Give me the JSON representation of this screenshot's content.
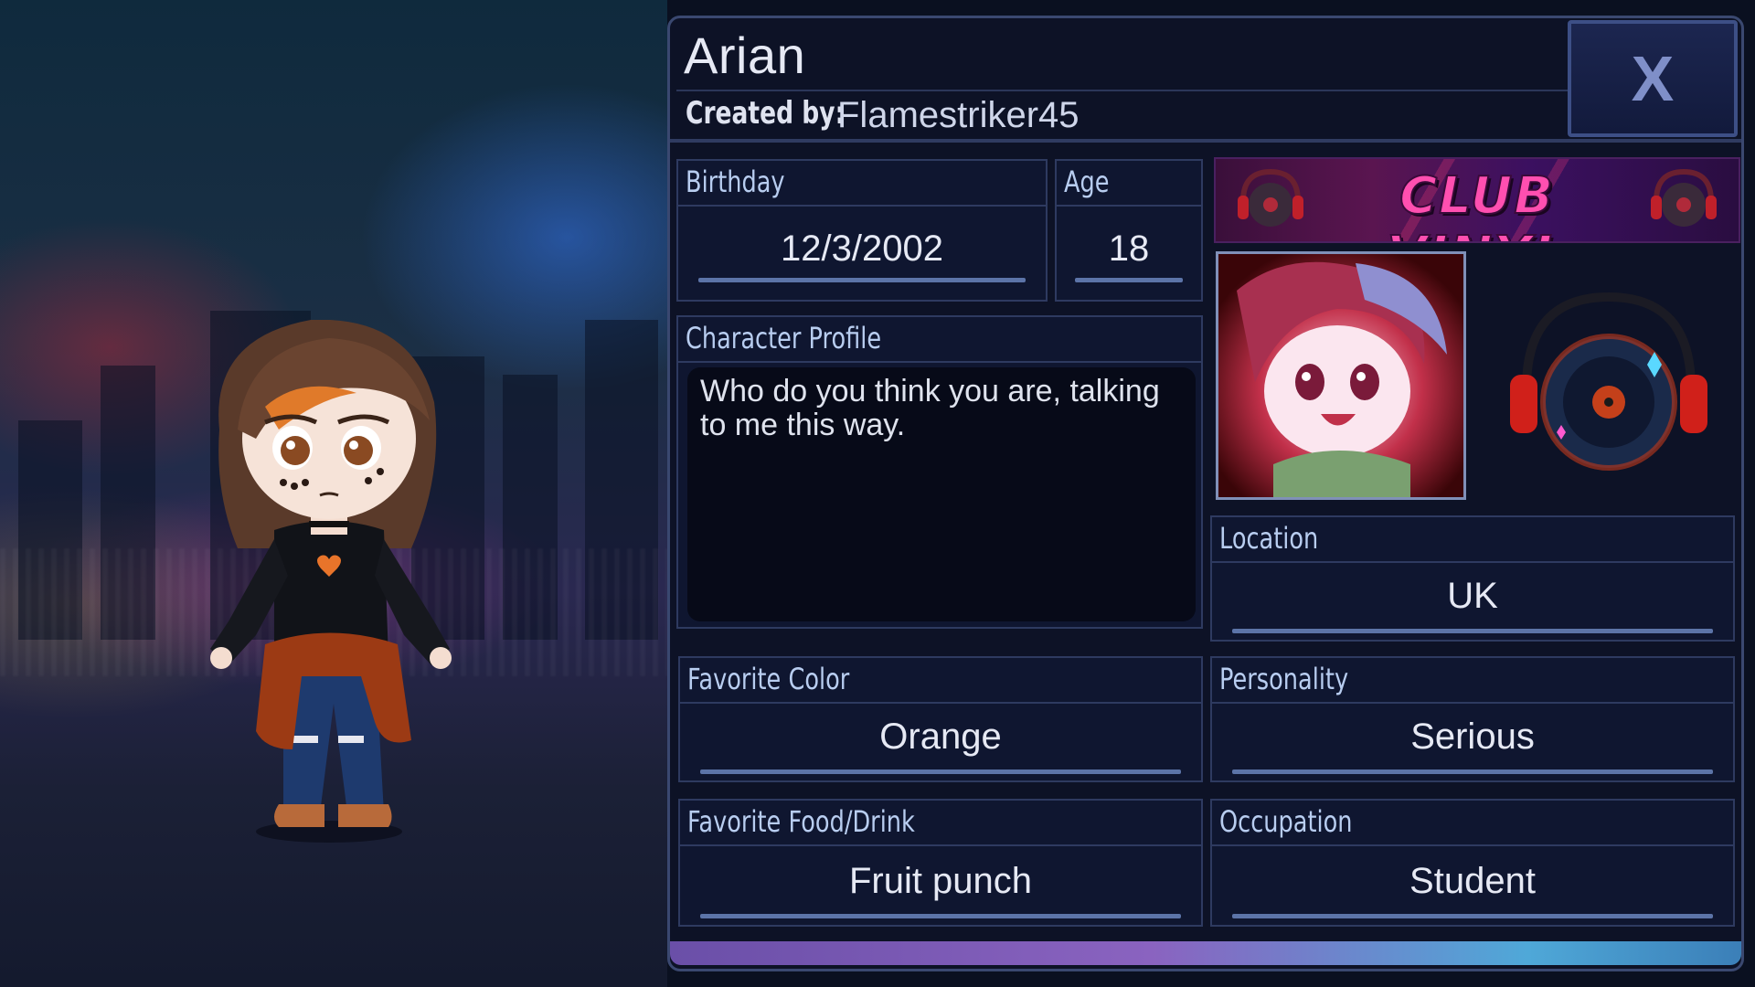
{
  "character": {
    "name": "Arian",
    "created_by_label": "Created by:",
    "creator": "Flamestriker45"
  },
  "close_button": {
    "label": "X"
  },
  "fields": {
    "birthday": {
      "label": "Birthday",
      "value": "12/3/2002"
    },
    "age": {
      "label": "Age",
      "value": "18"
    },
    "character_profile": {
      "label": "Character Profile",
      "value": "Who do you think you are, talking to me this way."
    },
    "location": {
      "label": "Location",
      "value": "UK"
    },
    "favorite_color": {
      "label": "Favorite Color",
      "value": "Orange"
    },
    "personality": {
      "label": "Personality",
      "value": "Serious"
    },
    "favorite_food": {
      "label": "Favorite Food/Drink",
      "value": "Fruit punch"
    },
    "occupation": {
      "label": "Occupation",
      "value": "Student"
    }
  },
  "banner": {
    "title": "CLUB VINYL"
  },
  "icons": {
    "close": "close-icon",
    "vinyl_disc": "vinyl-disc-icon",
    "headphones": "headphones-icon"
  },
  "colors": {
    "panel_bg": "#0d1226",
    "panel_border": "#3a4870",
    "label_text": "#b8cdf0",
    "value_text": "#e6e9f4",
    "banner_text": "#ff4fb0",
    "accent_bar_start": "#6a4fa8",
    "accent_bar_end": "#3b7fb8"
  }
}
